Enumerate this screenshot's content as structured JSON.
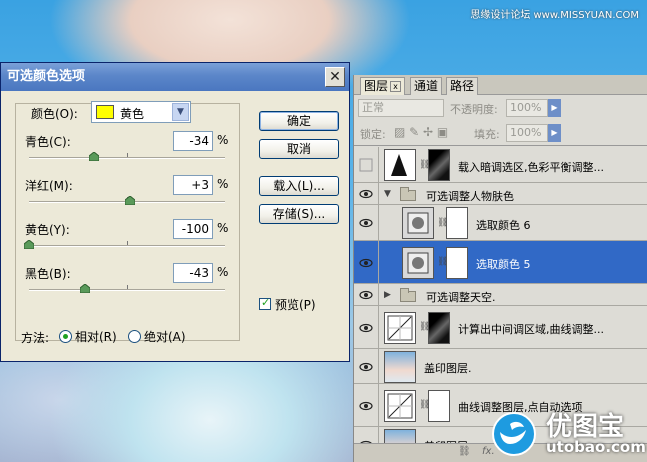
{
  "watermark_top": "思缘设计论坛 www.MISSYUAN.COM",
  "dialog": {
    "title": "可选颜色选项",
    "color_label": "颜色(O):",
    "color_value": "黄色",
    "swatch_color": "#ffff00",
    "sliders": [
      {
        "label": "青色(C):",
        "value": "-34",
        "unit": "%",
        "level": -34
      },
      {
        "label": "洋红(M):",
        "value": "+3",
        "unit": "%",
        "level": 3
      },
      {
        "label": "黄色(Y):",
        "value": "-100",
        "unit": "%",
        "level": -100
      },
      {
        "label": "黑色(B):",
        "value": "-43",
        "unit": "%",
        "level": -43
      }
    ],
    "buttons": {
      "ok": "确定",
      "cancel": "取消",
      "load": "载入(L)...",
      "save": "存储(S)..."
    },
    "preview_label": "预览(P)",
    "preview_checked": true,
    "method_label": "方法:",
    "method_relative": "相对(R)",
    "method_absolute": "绝对(A)",
    "method_selected": "relative"
  },
  "layers_panel": {
    "tabs": [
      "图层",
      "通道",
      "路径"
    ],
    "close_glyph": "x",
    "blend_mode": "正常",
    "opacity_label": "不透明度:",
    "opacity_value": "100%",
    "lock_label": "锁定:",
    "fill_label": "填充:",
    "fill_value": "100%",
    "layers": [
      {
        "name": "载入暗调选区,色彩平衡调整...",
        "visible": false,
        "type": "adjust-mask"
      },
      {
        "name": "可选调整人物肤色",
        "visible": true,
        "type": "group-open"
      },
      {
        "name": "选取颜色 6",
        "visible": true,
        "type": "selective"
      },
      {
        "name": "选取颜色 5",
        "visible": true,
        "type": "selective",
        "selected": true
      },
      {
        "name": "可选调整天空.",
        "visible": true,
        "type": "group-closed"
      },
      {
        "name": "计算出中间调区域,曲线调整...",
        "visible": true,
        "type": "curves-mask"
      },
      {
        "name": "盖印图层.",
        "visible": true,
        "type": "pixel"
      },
      {
        "name": "曲线调整图层,点自动选项",
        "visible": true,
        "type": "curves"
      },
      {
        "name": "盖印图层",
        "visible": true,
        "type": "pixel"
      }
    ],
    "footer_text": "fx."
  },
  "brand": {
    "name": "优图宝",
    "domain": "utobao.com",
    "color": "#1e9be0"
  }
}
